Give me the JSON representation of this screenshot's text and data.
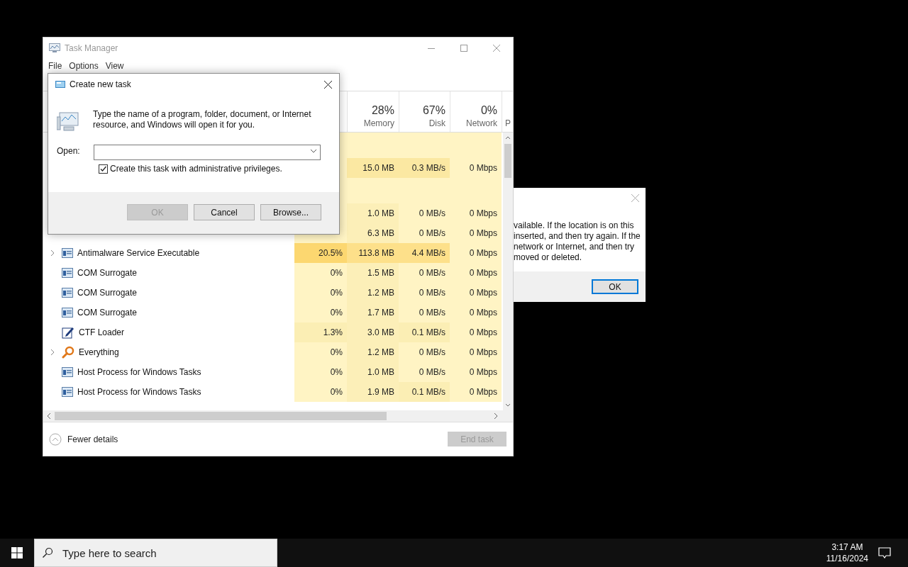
{
  "task_manager": {
    "title": "Task Manager",
    "menu": [
      "File",
      "Options",
      "View"
    ],
    "columns": [
      {
        "percent": "28%",
        "label": "Memory"
      },
      {
        "percent": "67%",
        "label": "Disk"
      },
      {
        "percent": "0%",
        "label": "Network"
      },
      {
        "label": "P"
      }
    ],
    "rows": [
      {
        "kind": "blank"
      },
      {
        "kind": "covered",
        "memory": {
          "text": "15.0 MB",
          "color": "#fbe8a2"
        },
        "disk": {
          "text": "0.3 MB/s",
          "color": "#fbe8a2"
        },
        "network": {
          "text": "0 Mbps",
          "color": "#fff4c4"
        }
      },
      {
        "kind": "blank"
      },
      {
        "kind": "covered",
        "memory": {
          "text": "1.0 MB",
          "color": "#fcefb8"
        },
        "disk": {
          "text": "0 MB/s",
          "color": "#fff4c4"
        },
        "network": {
          "text": "0 Mbps",
          "color": "#fff4c4"
        }
      },
      {
        "kind": "covered",
        "memory": {
          "text": "6.3 MB",
          "color": "#fcefb8"
        },
        "disk": {
          "text": "0 MB/s",
          "color": "#fff4c4"
        },
        "network": {
          "text": "0 Mbps",
          "color": "#fff4c4"
        }
      },
      {
        "kind": "service",
        "name": "Antimalware Service Executable",
        "expandable": true,
        "cpu": {
          "text": "20.5%",
          "color": "#fcd770"
        },
        "memory": {
          "text": "113.8 MB",
          "color": "#fde08a"
        },
        "disk": {
          "text": "4.4 MB/s",
          "color": "#fde08a"
        },
        "network": {
          "text": "0 Mbps",
          "color": "#fff4c4"
        }
      },
      {
        "kind": "service",
        "name": "COM Surrogate",
        "expandable": false,
        "cpu": {
          "text": "0%",
          "color": "#fff4c4"
        },
        "memory": {
          "text": "1.5 MB",
          "color": "#fcefb8"
        },
        "disk": {
          "text": "0 MB/s",
          "color": "#fff4c4"
        },
        "network": {
          "text": "0 Mbps",
          "color": "#fff4c4"
        }
      },
      {
        "kind": "service",
        "name": "COM Surrogate",
        "expandable": false,
        "cpu": {
          "text": "0%",
          "color": "#fff4c4"
        },
        "memory": {
          "text": "1.2 MB",
          "color": "#fcefb8"
        },
        "disk": {
          "text": "0 MB/s",
          "color": "#fff4c4"
        },
        "network": {
          "text": "0 Mbps",
          "color": "#fff4c4"
        }
      },
      {
        "kind": "service",
        "name": "COM Surrogate",
        "expandable": false,
        "cpu": {
          "text": "0%",
          "color": "#fff4c4"
        },
        "memory": {
          "text": "1.7 MB",
          "color": "#fcefb8"
        },
        "disk": {
          "text": "0 MB/s",
          "color": "#fff4c4"
        },
        "network": {
          "text": "0 Mbps",
          "color": "#fff4c4"
        }
      },
      {
        "kind": "editor",
        "name": "CTF Loader",
        "expandable": false,
        "cpu": {
          "text": "1.3%",
          "color": "#fbeeb4"
        },
        "memory": {
          "text": "3.0 MB",
          "color": "#fcefb8"
        },
        "disk": {
          "text": "0.1 MB/s",
          "color": "#fbeeb4"
        },
        "network": {
          "text": "0 Mbps",
          "color": "#fff4c4"
        }
      },
      {
        "kind": "finder",
        "name": "Everything",
        "expandable": true,
        "cpu": {
          "text": "0%",
          "color": "#fff4c4"
        },
        "memory": {
          "text": "1.2 MB",
          "color": "#fcefb8"
        },
        "disk": {
          "text": "0 MB/s",
          "color": "#fff4c4"
        },
        "network": {
          "text": "0 Mbps",
          "color": "#fff4c4"
        }
      },
      {
        "kind": "service",
        "name": "Host Process for Windows Tasks",
        "expandable": false,
        "cpu": {
          "text": "0%",
          "color": "#fff4c4"
        },
        "memory": {
          "text": "1.0 MB",
          "color": "#fcefb8"
        },
        "disk": {
          "text": "0 MB/s",
          "color": "#fff4c4"
        },
        "network": {
          "text": "0 Mbps",
          "color": "#fff4c4"
        }
      },
      {
        "kind": "service",
        "name": "Host Process for Windows Tasks",
        "expandable": false,
        "cpu": {
          "text": "0%",
          "color": "#fff4c4"
        },
        "memory": {
          "text": "1.9 MB",
          "color": "#fcefb8"
        },
        "disk": {
          "text": "0.1 MB/s",
          "color": "#fbeeb4"
        },
        "network": {
          "text": "0 Mbps",
          "color": "#fff4c4"
        }
      }
    ],
    "footer": {
      "toggle": "Fewer details",
      "end_task": {
        "label": "End task",
        "disabled": true
      }
    }
  },
  "create_task_dialog": {
    "title": "Create new task",
    "message": "Type the name of a program, folder, document, or Internet resource, and Windows will open it for you.",
    "open_label": "Open:",
    "checkbox": {
      "label": "Create this task with administrative privileges.",
      "checked": true
    },
    "buttons": [
      {
        "label": "OK",
        "disabled": true
      },
      {
        "label": "Cancel",
        "disabled": false
      },
      {
        "label": "Browse...",
        "disabled": false
      }
    ]
  },
  "error_dialog": {
    "lines": [
      "vailable. If the location is on this",
      "inserted, and then try again. If the",
      "network or Internet, and then try",
      "moved or deleted."
    ],
    "button": "OK"
  },
  "taskbar": {
    "search_placeholder": "Type here to search",
    "time": "3:17 AM",
    "date": "11/16/2024"
  }
}
